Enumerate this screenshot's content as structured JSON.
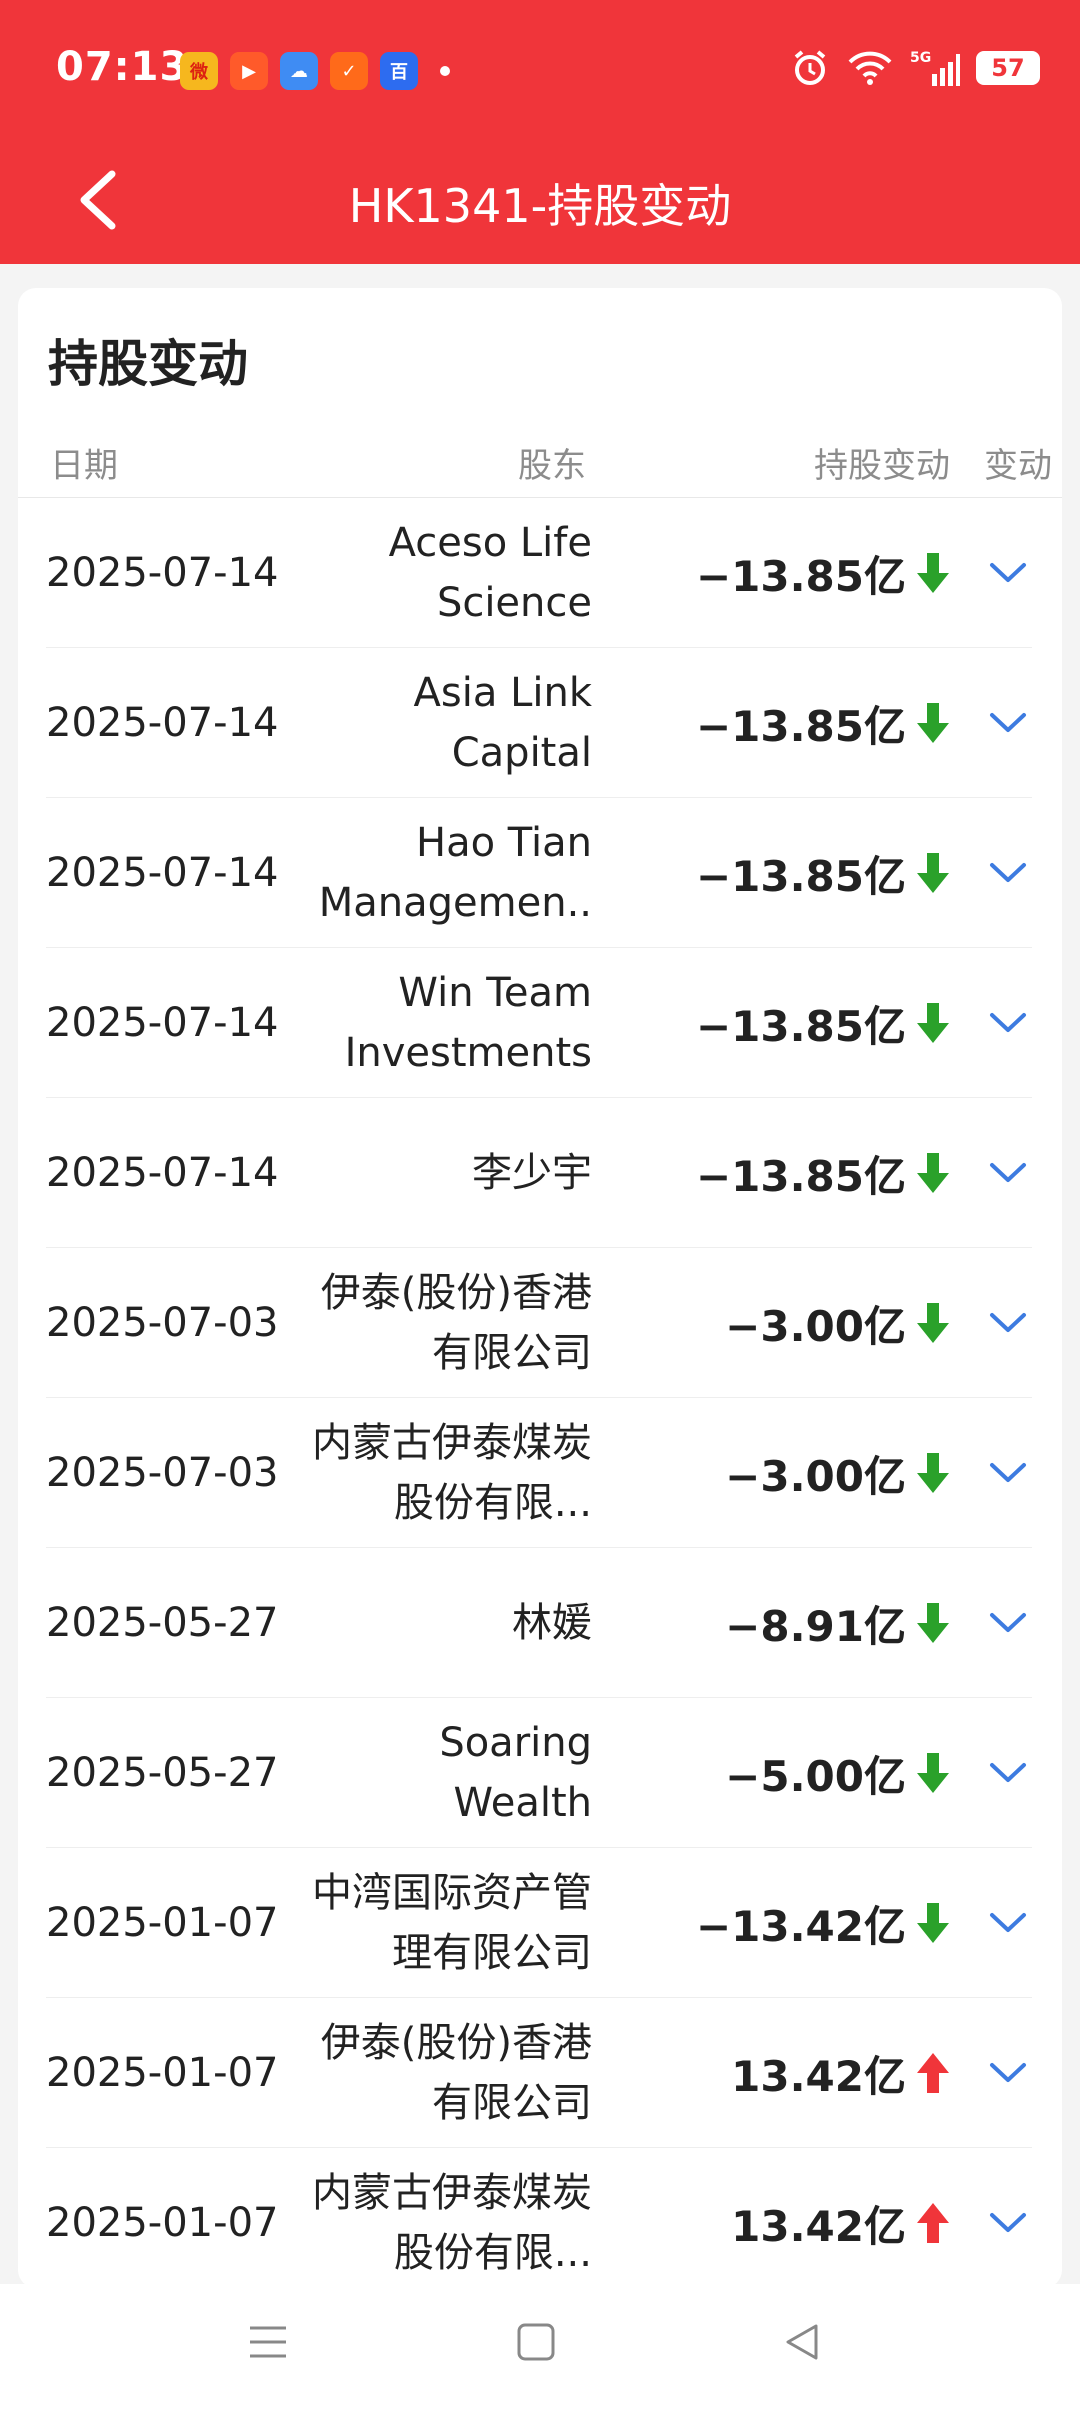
{
  "status_bar": {
    "time": "07:13",
    "battery": "57"
  },
  "header": {
    "title": "HK1341-持股变动"
  },
  "card": {
    "title": "持股变动"
  },
  "table": {
    "headers": {
      "date": "日期",
      "holder": "股东",
      "change": "持股变动",
      "more": "变动"
    },
    "rows": [
      {
        "date": "2025-07-14",
        "holder": "Aceso Life Science",
        "change": "−13.85亿",
        "direction": "down"
      },
      {
        "date": "2025-07-14",
        "holder": "Asia Link Capital",
        "change": "−13.85亿",
        "direction": "down"
      },
      {
        "date": "2025-07-14",
        "holder": "Hao Tian Managemen..",
        "change": "−13.85亿",
        "direction": "down"
      },
      {
        "date": "2025-07-14",
        "holder": "Win Team Investments",
        "change": "−13.85亿",
        "direction": "down"
      },
      {
        "date": "2025-07-14",
        "holder": "李少宇",
        "change": "−13.85亿",
        "direction": "down"
      },
      {
        "date": "2025-07-03",
        "holder": "伊泰(股份)香港有限公司",
        "change": "−3.00亿",
        "direction": "down"
      },
      {
        "date": "2025-07-03",
        "holder": "内蒙古伊泰煤炭股份有限...",
        "change": "−3.00亿",
        "direction": "down"
      },
      {
        "date": "2025-05-27",
        "holder": "林媛",
        "change": "−8.91亿",
        "direction": "down"
      },
      {
        "date": "2025-05-27",
        "holder": "Soaring Wealth",
        "change": "−5.00亿",
        "direction": "down"
      },
      {
        "date": "2025-01-07",
        "holder": "中湾国际资产管理有限公司",
        "change": "−13.42亿",
        "direction": "down"
      },
      {
        "date": "2025-01-07",
        "holder": "伊泰(股份)香港有限公司",
        "change": "13.42亿",
        "direction": "up"
      },
      {
        "date": "2025-01-07",
        "holder": "内蒙古伊泰煤炭股份有限...",
        "change": "13.42亿",
        "direction": "up"
      }
    ]
  },
  "colors": {
    "brand_red": "#f0353a",
    "down_green": "#2aa12a",
    "up_red": "#f0353a",
    "chevron_blue": "#3d7be0"
  }
}
